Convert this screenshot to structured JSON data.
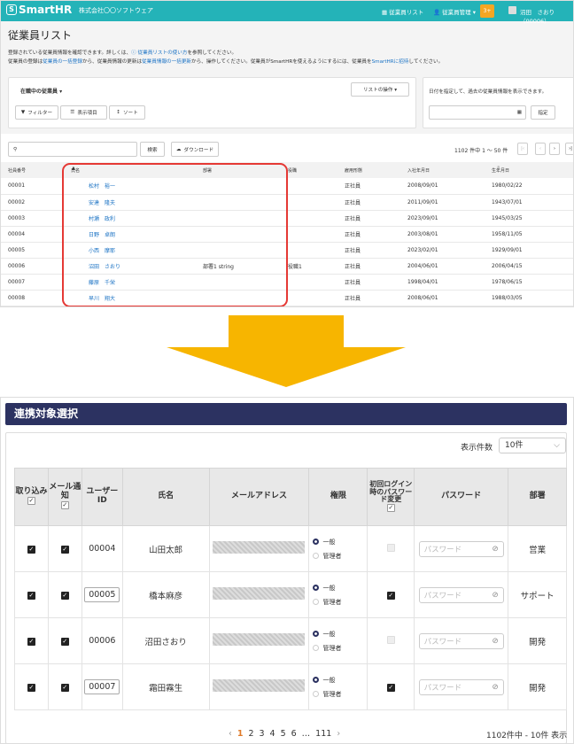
{
  "top": {
    "logo": "SmartHR",
    "company": "株式会社〇〇ソフトウェア",
    "nav": [
      "従業員リスト",
      "従業員管理 ▾"
    ],
    "notif": "3+",
    "user": "沼田　さおり（00006）",
    "title": "従業員リスト",
    "desc1_a": "登録されている従業員情報を確認できます。詳しくは、",
    "desc1_link": "従業員リストの使い方",
    "desc1_b": "を参照してください。",
    "desc2_a": "従業員の登録は",
    "desc2_l1": "従業員の一括登録",
    "desc2_b": "から、従業員情報の更新は",
    "desc2_l2": "従業員情報の一括更新",
    "desc2_c": "から、操作してください。従業員がSmartHRを使えるようにするには、従業員を",
    "desc2_l3": "SmartHRに招待",
    "desc2_d": "してください。",
    "filter_select": "在職中の従業員 ▾",
    "list_ops": "リストの操作 ▾",
    "filter_btn": "フィルター",
    "columns_btn": "表示項目",
    "sort_btn": "ソート",
    "date_desc": "日付を指定して、過去の従業員情報を表示できます。",
    "date_btn": "指定",
    "search_btn": "検索",
    "download_btn": "ダウンロード",
    "count": "1102 件中 1 〜 50 件",
    "headers": [
      "社員番号",
      "氏名",
      "部署",
      "役職",
      "雇用形態",
      "入社年月日",
      "生年月日"
    ],
    "rows": [
      [
        "00001",
        "松村　裕一",
        "",
        "",
        "正社員",
        "2008/09/01",
        "1980/02/22"
      ],
      [
        "00002",
        "安達　隆夫",
        "",
        "",
        "正社員",
        "2011/09/01",
        "1943/07/01"
      ],
      [
        "00003",
        "村瀬　政利",
        "",
        "",
        "正社員",
        "2023/09/01",
        "1945/03/25"
      ],
      [
        "00004",
        "日野　卓朗",
        "",
        "",
        "正社員",
        "2003/08/01",
        "1958/11/05"
      ],
      [
        "00005",
        "小西　摩耶",
        "",
        "",
        "正社員",
        "2023/02/01",
        "1929/09/01"
      ],
      [
        "00006",
        "沼田　さおり",
        "部署1 string",
        "役職1",
        "正社員",
        "2004/06/01",
        "2006/04/15"
      ],
      [
        "00007",
        "藤原　千栄",
        "",
        "",
        "正社員",
        "1998/04/01",
        "1978/06/15"
      ],
      [
        "00008",
        "早川　翔大",
        "",
        "",
        "正社員",
        "2008/06/01",
        "1988/03/05"
      ]
    ]
  },
  "bottom": {
    "title": "連携対象選択",
    "page_size_label": "表示件数",
    "page_size": "10件",
    "headers": [
      "取り込み",
      "メール通知",
      "ユーザーID",
      "氏名",
      "メールアドレス",
      "権限",
      "初回ログイン時のパスワード変更",
      "パスワード",
      "部署"
    ],
    "role_options": [
      "一般",
      "管理者"
    ],
    "password_placeholder": "パスワード",
    "rows": [
      {
        "id": "00004",
        "name": "山田太郎",
        "id_input": false,
        "pw_change": false,
        "dept": "営業"
      },
      {
        "id": "00005",
        "name": "橋本麻彦",
        "id_input": true,
        "pw_change": true,
        "dept": "サポート"
      },
      {
        "id": "00006",
        "name": "沼田さおり",
        "id_input": false,
        "pw_change": false,
        "dept": "開発"
      },
      {
        "id": "00007",
        "name": "霜田霧生",
        "id_input": true,
        "pw_change": true,
        "dept": "開発"
      }
    ],
    "pager": [
      "‹",
      "1",
      "2",
      "3",
      "4",
      "5",
      "6",
      "…",
      "111",
      "›"
    ],
    "count": "1102件中 - 10件 表示"
  }
}
